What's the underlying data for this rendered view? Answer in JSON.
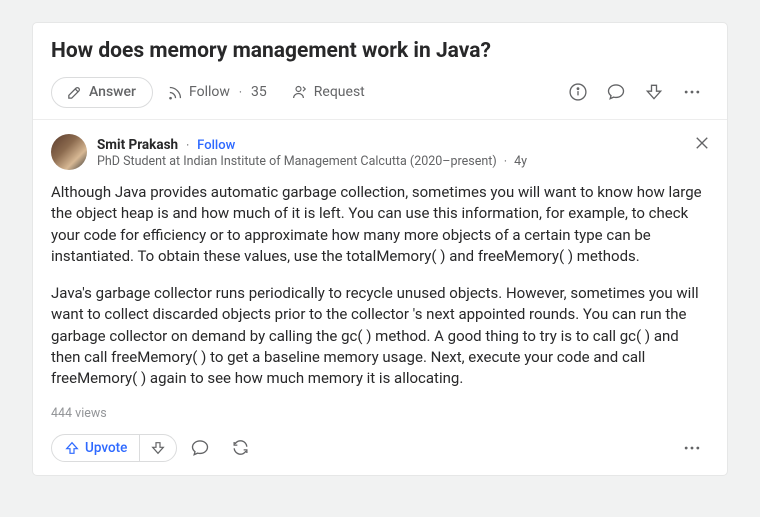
{
  "question": {
    "title": "How does memory management work in Java?",
    "actions": {
      "answer_label": "Answer",
      "follow_label": "Follow",
      "follow_count": "35",
      "request_label": "Request"
    }
  },
  "answer": {
    "author": {
      "name": "Smit Prakash",
      "follow_label": "Follow",
      "credential": "PhD Student at Indian Institute of Management Calcutta (2020–present)",
      "age": "4y"
    },
    "paragraphs": [
      "Although Java provides automatic garbage collection, sometimes you will want to know how large the object heap is and how much of it is left. You can use this information, for example, to check your code for efficiency or to approximate how many more objects of a certain type can be instantiated. To obtain these values, use the totalMemory( ) and freeMemory( ) methods.",
      "Java's garbage collector runs periodically to recycle unused objects. However, sometimes you will want to collect discarded objects prior to the collector 's next appointed rounds. You can run the garbage collector on demand by calling the gc( ) method. A good thing to try is to call gc( ) and then call freeMemory( ) to get a baseline memory usage. Next, execute your code and call freeMemory( ) again to see how much memory it is allocating."
    ],
    "views": "444 views",
    "upvote_label": "Upvote"
  }
}
